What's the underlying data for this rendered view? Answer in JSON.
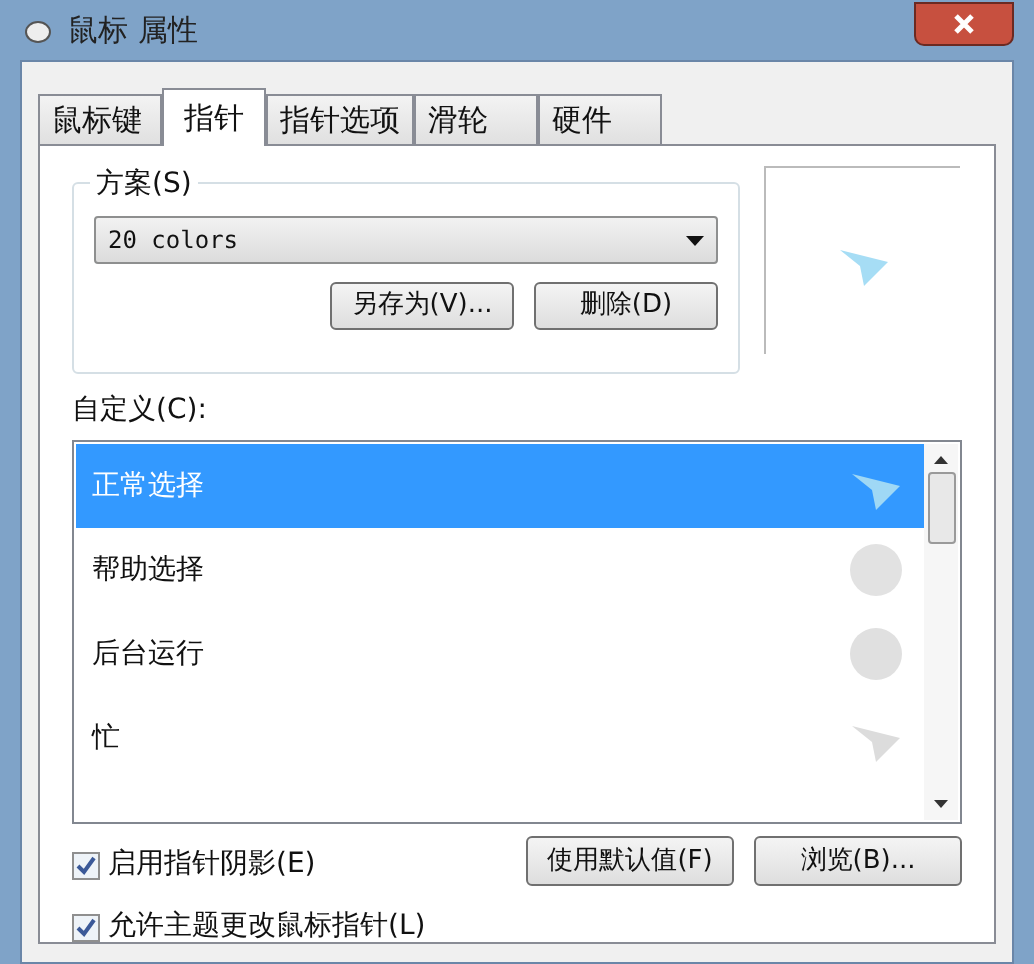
{
  "window": {
    "title": "鼠标 属性"
  },
  "tabs": [
    {
      "label": "鼠标键",
      "selected": false
    },
    {
      "label": "指针",
      "selected": true
    },
    {
      "label": "指针选项",
      "selected": false
    },
    {
      "label": "滑轮",
      "selected": false
    },
    {
      "label": "硬件",
      "selected": false
    }
  ],
  "scheme": {
    "label": "方案(S)",
    "value": "20 colors",
    "buttons": [
      "另存为(V)...",
      "删除(D)"
    ]
  },
  "custom": {
    "label": "自定义(C):",
    "rows": [
      {
        "label": "正常选择",
        "kind": "pointer",
        "selected": true
      },
      {
        "label": "帮助选择",
        "kind": "help",
        "selected": false
      },
      {
        "label": "后台运行",
        "kind": "background",
        "selected": false
      },
      {
        "label": "忙",
        "kind": "busy",
        "selected": false
      }
    ]
  },
  "options": [
    {
      "label": "启用指针阴影(E)",
      "checked": true
    },
    {
      "label": "允许主题更改鼠标指针(L)",
      "checked": true
    }
  ],
  "buttons": [
    "使用默认值(F)",
    "浏览(B)..."
  ]
}
